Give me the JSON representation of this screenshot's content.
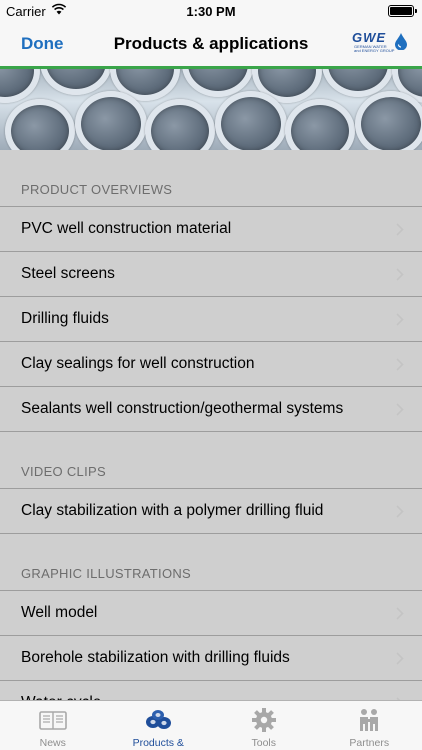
{
  "status_bar": {
    "carrier": "Carrier",
    "time": "1:30 PM"
  },
  "nav": {
    "done_label": "Done",
    "title": "Products & applications",
    "logo_text": "GWE",
    "logo_subtext": "GERMAN WATER and ENERGY GROUP"
  },
  "sections": [
    {
      "header": "PRODUCT OVERVIEWS",
      "items": [
        {
          "label": "PVC well construction material"
        },
        {
          "label": "Steel screens"
        },
        {
          "label": "Drilling fluids"
        },
        {
          "label": "Clay sealings for well construction"
        },
        {
          "label": "Sealants well construction/geothermal systems"
        }
      ]
    },
    {
      "header": "VIDEO CLIPS",
      "items": [
        {
          "label": "Clay stabilization with a polymer drilling fluid"
        }
      ]
    },
    {
      "header": "GRAPHIC ILLUSTRATIONS",
      "items": [
        {
          "label": "Well model"
        },
        {
          "label": "Borehole stabilization with drilling fluids"
        },
        {
          "label": "Water cycle"
        }
      ]
    }
  ],
  "tabs": [
    {
      "label": "News",
      "icon": "newspaper-icon",
      "active": false
    },
    {
      "label": "Products & applications",
      "icon": "pipes-icon",
      "active": true
    },
    {
      "label": "Tools",
      "icon": "gear-icon",
      "active": false
    },
    {
      "label": "Partners",
      "icon": "handshake-icon",
      "active": false
    }
  ],
  "colors": {
    "accent": "#1f6fbf",
    "brand": "#1f4e9a",
    "divider_green": "#3aa54a",
    "background": "#cfcfcf"
  }
}
